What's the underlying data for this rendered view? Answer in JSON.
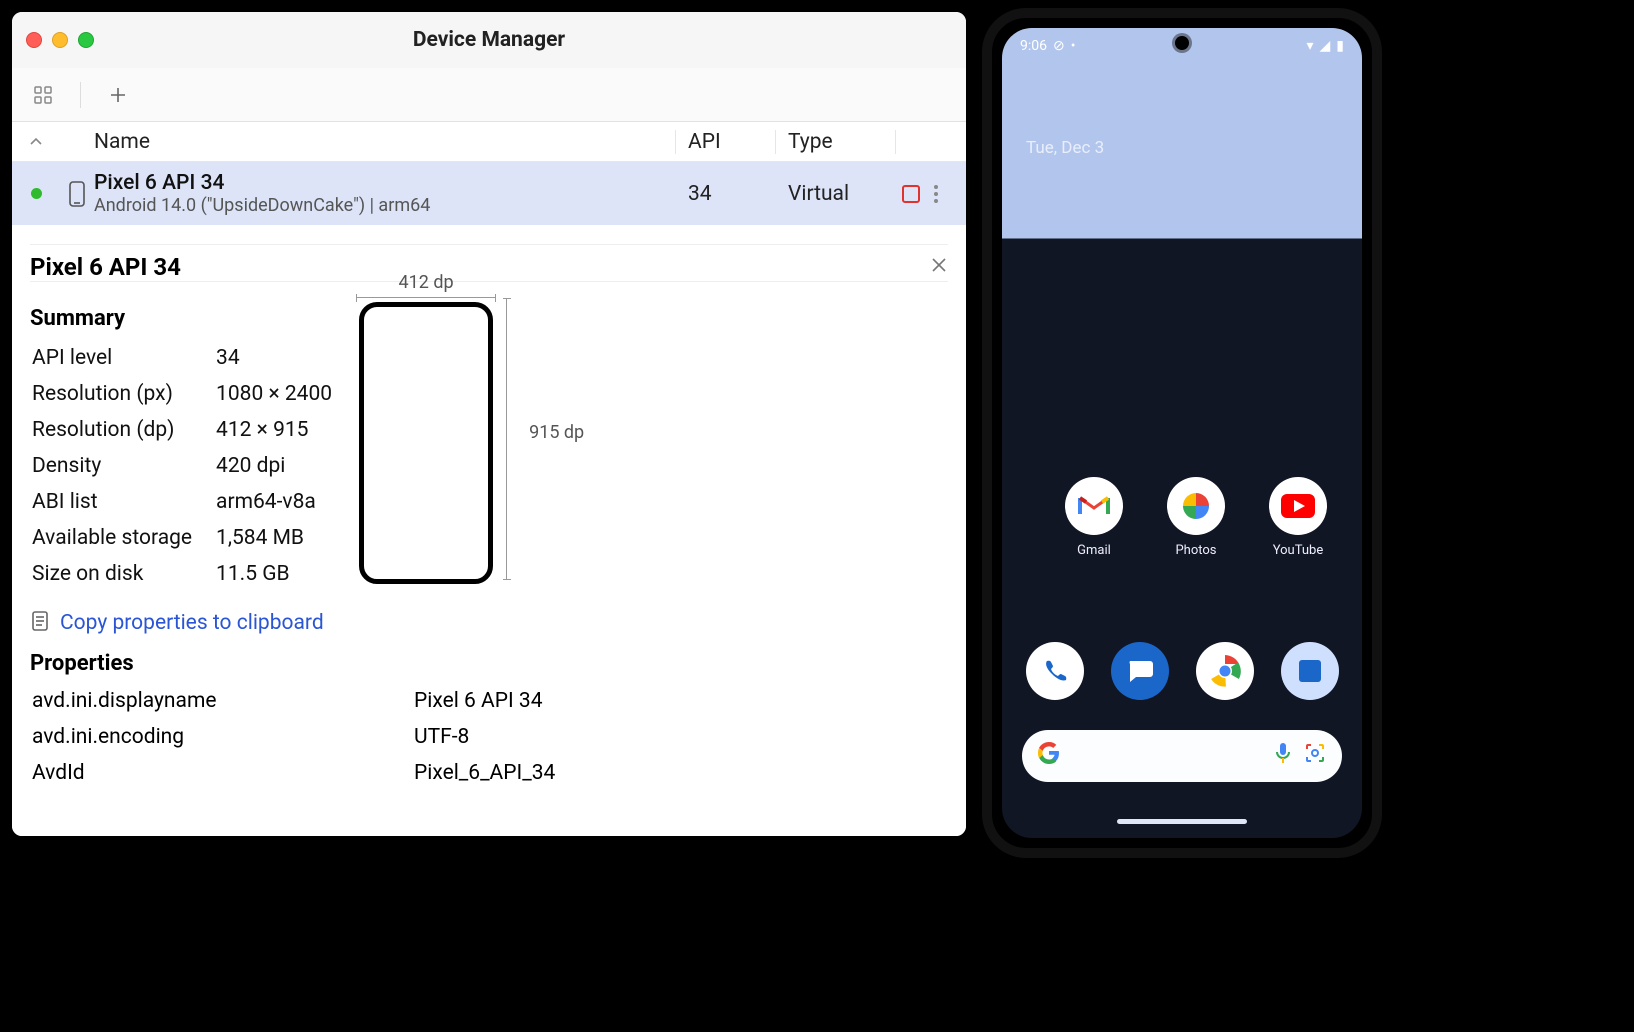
{
  "window": {
    "title": "Device Manager"
  },
  "columns": {
    "name": "Name",
    "api": "API",
    "type": "Type"
  },
  "device": {
    "name": "Pixel 6 API 34",
    "subtitle": "Android 14.0 (\"UpsideDownCake\") | arm64",
    "api": "34",
    "type": "Virtual"
  },
  "detail": {
    "title": "Pixel 6 API 34",
    "summary_heading": "Summary",
    "labels": {
      "api": "API level",
      "res_px": "Resolution (px)",
      "res_dp": "Resolution (dp)",
      "density": "Density",
      "abi": "ABI list",
      "avail": "Available storage",
      "size": "Size on disk"
    },
    "values": {
      "api": "34",
      "res_px": "1080 × 2400",
      "res_dp": "412 × 915",
      "density": "420 dpi",
      "abi": "arm64-v8a",
      "avail": "1,584 MB",
      "size": "11.5 GB"
    },
    "width_label": "412 dp",
    "height_label": "915 dp",
    "copy_link": "Copy properties to clipboard",
    "props_heading": "Properties",
    "props": [
      {
        "k": "avd.ini.displayname",
        "v": "Pixel 6 API 34"
      },
      {
        "k": "avd.ini.encoding",
        "v": "UTF-8"
      },
      {
        "k": "AvdId",
        "v": "Pixel_6_API_34"
      }
    ]
  },
  "emulator": {
    "clock": "9:06",
    "date": "Tue, Dec 3",
    "apps_top": [
      {
        "name": "Gmail"
      },
      {
        "name": "Photos"
      },
      {
        "name": "YouTube"
      }
    ]
  }
}
